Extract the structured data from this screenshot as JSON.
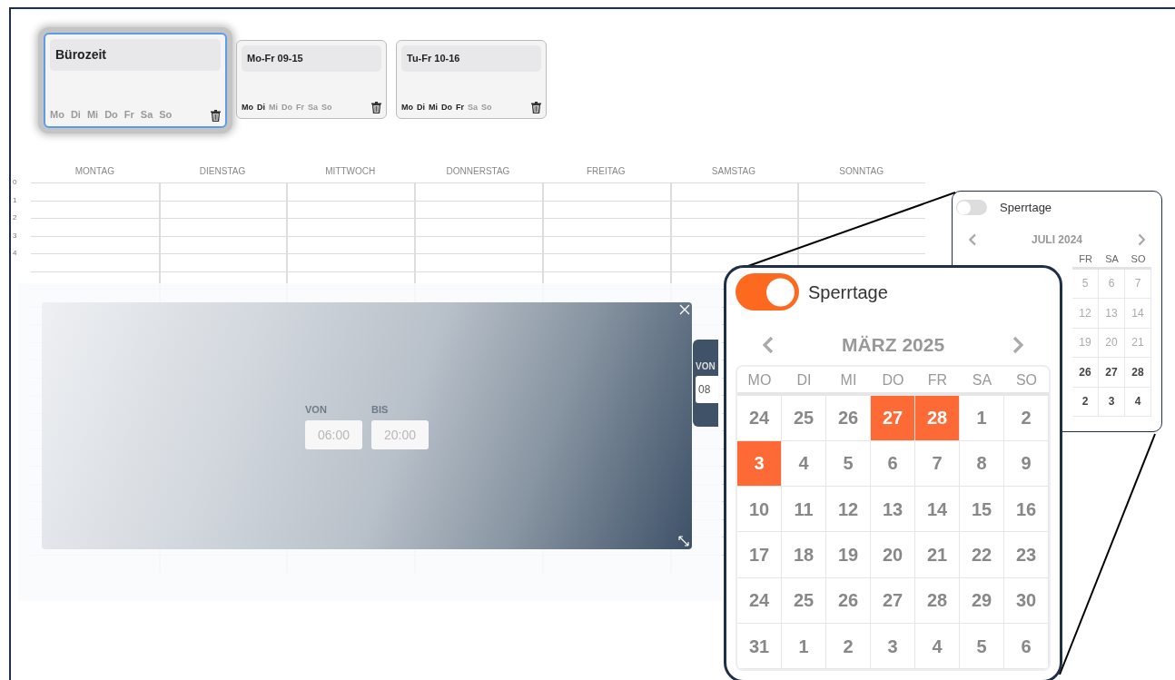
{
  "shift_cards": [
    {
      "title": "Bürozeit",
      "selected": true,
      "days": [
        {
          "label": "Mo",
          "active": false
        },
        {
          "label": "Di",
          "active": false
        },
        {
          "label": "Mi",
          "active": false
        },
        {
          "label": "Do",
          "active": false
        },
        {
          "label": "Fr",
          "active": false
        },
        {
          "label": "Sa",
          "active": false
        },
        {
          "label": "So",
          "active": false
        }
      ]
    },
    {
      "title": "Mo-Fr 09-15",
      "selected": false,
      "days": [
        {
          "label": "Mo",
          "active": true
        },
        {
          "label": "Di",
          "active": true
        },
        {
          "label": "Mi",
          "active": false
        },
        {
          "label": "Do",
          "active": false
        },
        {
          "label": "Fr",
          "active": false
        },
        {
          "label": "Sa",
          "active": false
        },
        {
          "label": "So",
          "active": false
        }
      ]
    },
    {
      "title": "Tu-Fr 10-16",
      "selected": false,
      "days": [
        {
          "label": "Mo",
          "active": true
        },
        {
          "label": "Di",
          "active": true
        },
        {
          "label": "Mi",
          "active": true
        },
        {
          "label": "Do",
          "active": true
        },
        {
          "label": "Fr",
          "active": true
        },
        {
          "label": "Sa",
          "active": false
        },
        {
          "label": "So",
          "active": false
        }
      ]
    }
  ],
  "week_grid": {
    "columns": [
      "MONTAG",
      "DIENSTAG",
      "MITTWOCH",
      "DONNERSTAG",
      "FREITAG",
      "SAMSTAG",
      "SONNTAG"
    ],
    "hours": [
      "0",
      "1",
      "2",
      "3",
      "4"
    ]
  },
  "time_dialog": {
    "from_label": "VON",
    "from_value": "06:00",
    "to_label": "BIS",
    "to_value": "20:00"
  },
  "side_panel_peek": {
    "label": "VON",
    "value": "08"
  },
  "small_calendar": {
    "toggle_label": "Sperrtage",
    "toggle_on": false,
    "month": "JULI 2024",
    "weekdays": [
      "FR",
      "SA",
      "SO"
    ],
    "weeks": [
      [
        {
          "label": "5",
          "muted": true
        },
        {
          "label": "6",
          "muted": true
        },
        {
          "label": "7",
          "muted": true
        }
      ],
      [
        {
          "label": "12",
          "muted": true
        },
        {
          "label": "13",
          "muted": true
        },
        {
          "label": "14",
          "muted": true
        }
      ],
      [
        {
          "label": "19",
          "muted": true
        },
        {
          "label": "20",
          "muted": true
        },
        {
          "label": "21",
          "muted": true
        }
      ],
      [
        {
          "label": "26",
          "muted": false
        },
        {
          "label": "27",
          "muted": false
        },
        {
          "label": "28",
          "muted": false
        }
      ],
      [
        {
          "label": "2",
          "muted": false
        },
        {
          "label": "3",
          "muted": false
        },
        {
          "label": "4",
          "muted": false
        }
      ]
    ]
  },
  "zoomed_calendar": {
    "toggle_label": "Sperrtage",
    "toggle_on": true,
    "month": "MÄRZ 2025",
    "weekdays": [
      "MO",
      "DI",
      "MI",
      "DO",
      "FR",
      "SA",
      "SO"
    ],
    "weeks": [
      [
        {
          "label": "24",
          "selected": false
        },
        {
          "label": "25",
          "selected": false
        },
        {
          "label": "26",
          "selected": false
        },
        {
          "label": "27",
          "selected": true
        },
        {
          "label": "28",
          "selected": true
        },
        {
          "label": "1",
          "selected": false
        },
        {
          "label": "2",
          "selected": false
        }
      ],
      [
        {
          "label": "3",
          "selected": true
        },
        {
          "label": "4",
          "selected": false
        },
        {
          "label": "5",
          "selected": false
        },
        {
          "label": "6",
          "selected": false
        },
        {
          "label": "7",
          "selected": false
        },
        {
          "label": "8",
          "selected": false
        },
        {
          "label": "9",
          "selected": false
        }
      ],
      [
        {
          "label": "10",
          "selected": false
        },
        {
          "label": "11",
          "selected": false
        },
        {
          "label": "12",
          "selected": false
        },
        {
          "label": "13",
          "selected": false
        },
        {
          "label": "14",
          "selected": false
        },
        {
          "label": "15",
          "selected": false
        },
        {
          "label": "16",
          "selected": false
        }
      ],
      [
        {
          "label": "17",
          "selected": false
        },
        {
          "label": "18",
          "selected": false
        },
        {
          "label": "19",
          "selected": false
        },
        {
          "label": "20",
          "selected": false
        },
        {
          "label": "21",
          "selected": false
        },
        {
          "label": "22",
          "selected": false
        },
        {
          "label": "23",
          "selected": false
        }
      ],
      [
        {
          "label": "24",
          "selected": false
        },
        {
          "label": "25",
          "selected": false
        },
        {
          "label": "26",
          "selected": false
        },
        {
          "label": "27",
          "selected": false
        },
        {
          "label": "28",
          "selected": false
        },
        {
          "label": "29",
          "selected": false
        },
        {
          "label": "30",
          "selected": false
        }
      ],
      [
        {
          "label": "31",
          "selected": false
        },
        {
          "label": "1",
          "selected": false
        },
        {
          "label": "2",
          "selected": false
        },
        {
          "label": "3",
          "selected": false
        },
        {
          "label": "4",
          "selected": false
        },
        {
          "label": "5",
          "selected": false
        },
        {
          "label": "6",
          "selected": false
        }
      ]
    ]
  }
}
